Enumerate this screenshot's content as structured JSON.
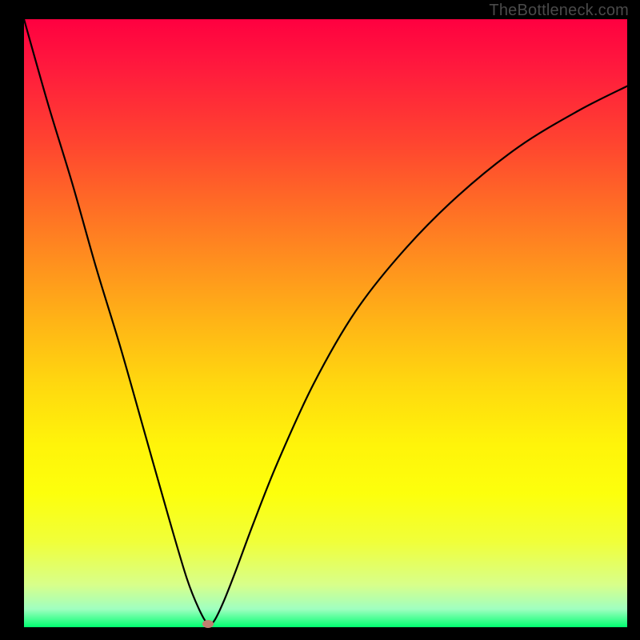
{
  "attribution": "TheBottleneck.com",
  "chart_data": {
    "type": "line",
    "title": "",
    "xlabel": "",
    "ylabel": "",
    "xlim": [
      0,
      100
    ],
    "ylim": [
      0,
      100
    ],
    "series": [
      {
        "name": "bottleneck-curve",
        "x": [
          0,
          4,
          8,
          12,
          16,
          20,
          24,
          27,
          29,
          30.5,
          31.5,
          33,
          35,
          38,
          42,
          48,
          55,
          63,
          72,
          82,
          92,
          100
        ],
        "y": [
          100,
          86,
          73,
          59,
          46,
          32,
          18,
          8,
          3,
          0.5,
          1,
          4,
          9,
          17,
          27,
          40,
          52,
          62,
          71,
          79,
          85,
          89
        ]
      }
    ],
    "marker": {
      "x": 30.5,
      "y": 0.5,
      "name": "optimal-point"
    },
    "background": {
      "type": "vertical-gradient",
      "stops": [
        {
          "pos": 0,
          "color": "#ff0040"
        },
        {
          "pos": 50,
          "color": "#ffd80f"
        },
        {
          "pos": 100,
          "color": "#00ff70"
        }
      ]
    }
  }
}
